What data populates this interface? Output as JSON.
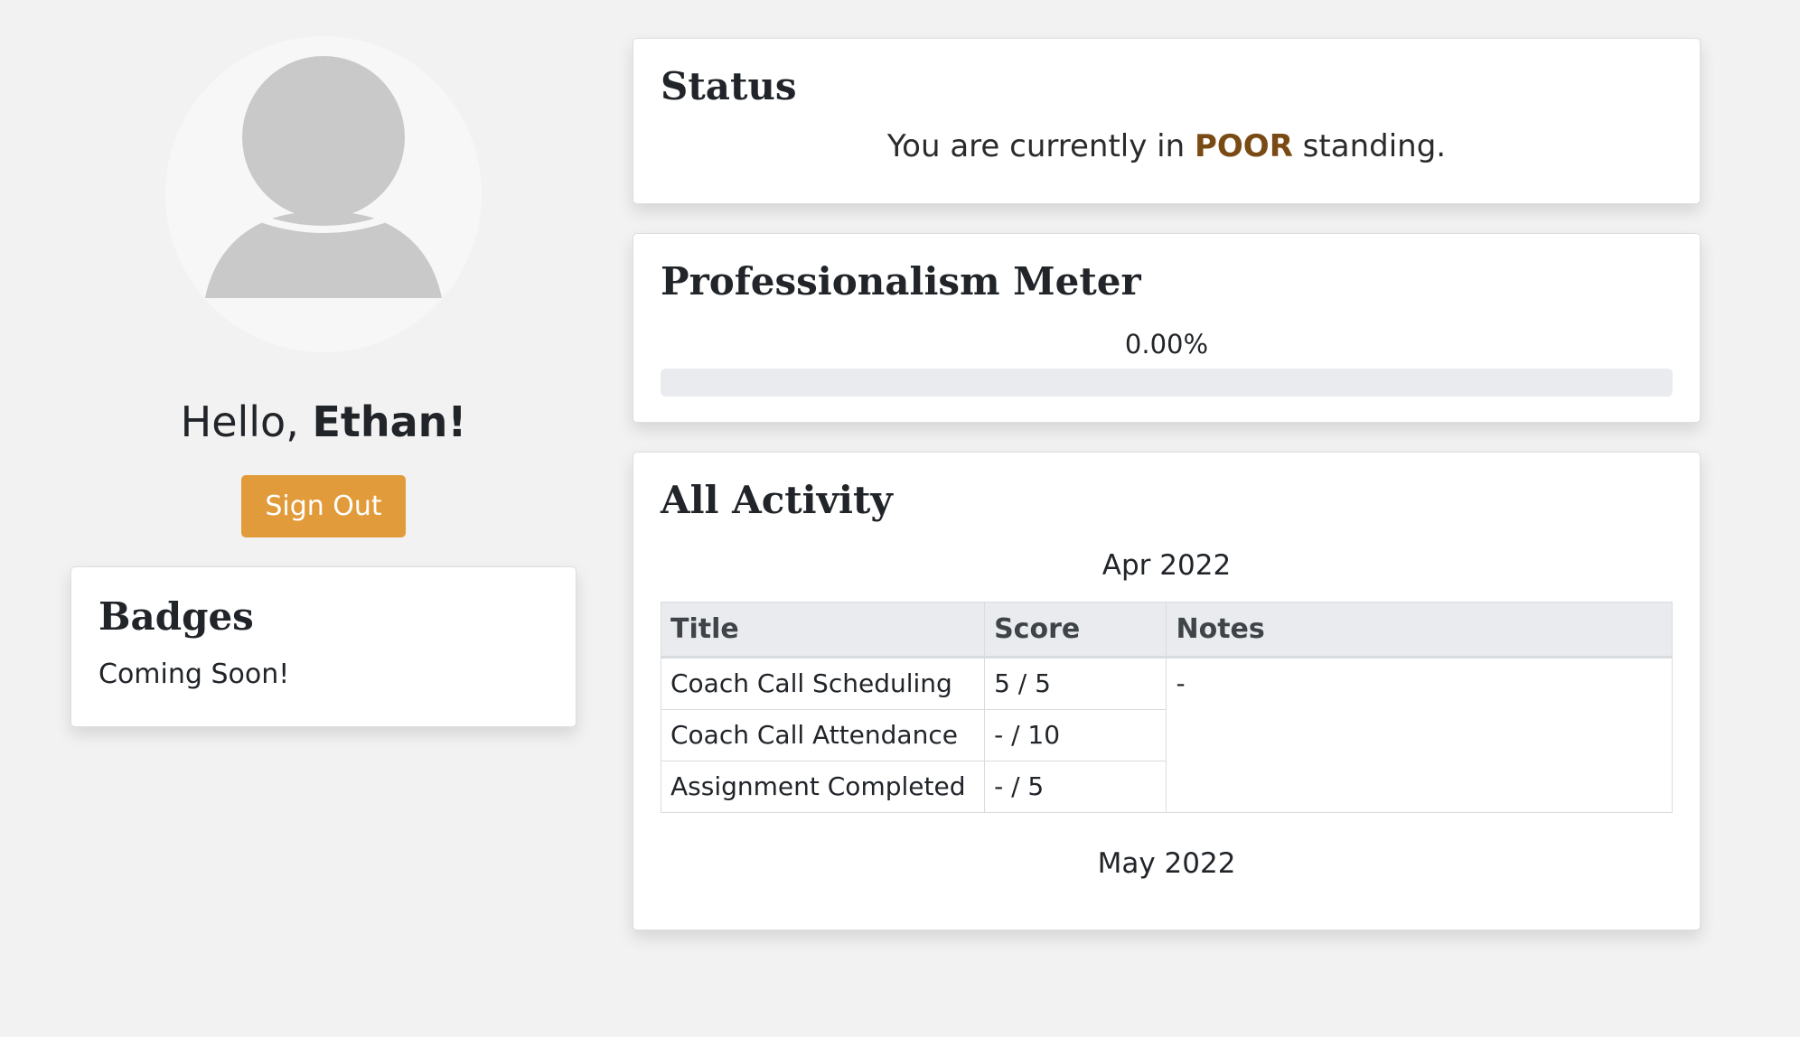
{
  "profile": {
    "avatar_icon": "user-silhouette-icon",
    "greeting_prefix": "Hello, ",
    "user_name": "Ethan!",
    "sign_out_label": "Sign Out",
    "accent_color": "#e29b3a"
  },
  "badges": {
    "title": "Badges",
    "body": "Coming Soon!"
  },
  "status": {
    "title": "Status",
    "text_before": "You are currently in ",
    "level": "POOR",
    "text_after": " standing.",
    "level_color": "#7a4a14"
  },
  "meter": {
    "title": "Professionalism Meter",
    "value_label": "0.00%",
    "value_fraction": 0
  },
  "activity": {
    "title": "All Activity",
    "months": [
      {
        "label": "Apr 2022",
        "columns": [
          "Title",
          "Score",
          "Notes"
        ],
        "rows": [
          {
            "title": "Coach Call Scheduling",
            "score": "5 / 5"
          },
          {
            "title": "Coach Call Attendance",
            "score": "- / 10"
          },
          {
            "title": "Assignment Completed",
            "score": "- / 5"
          }
        ],
        "notes": "-"
      },
      {
        "label": "May 2022"
      }
    ]
  }
}
